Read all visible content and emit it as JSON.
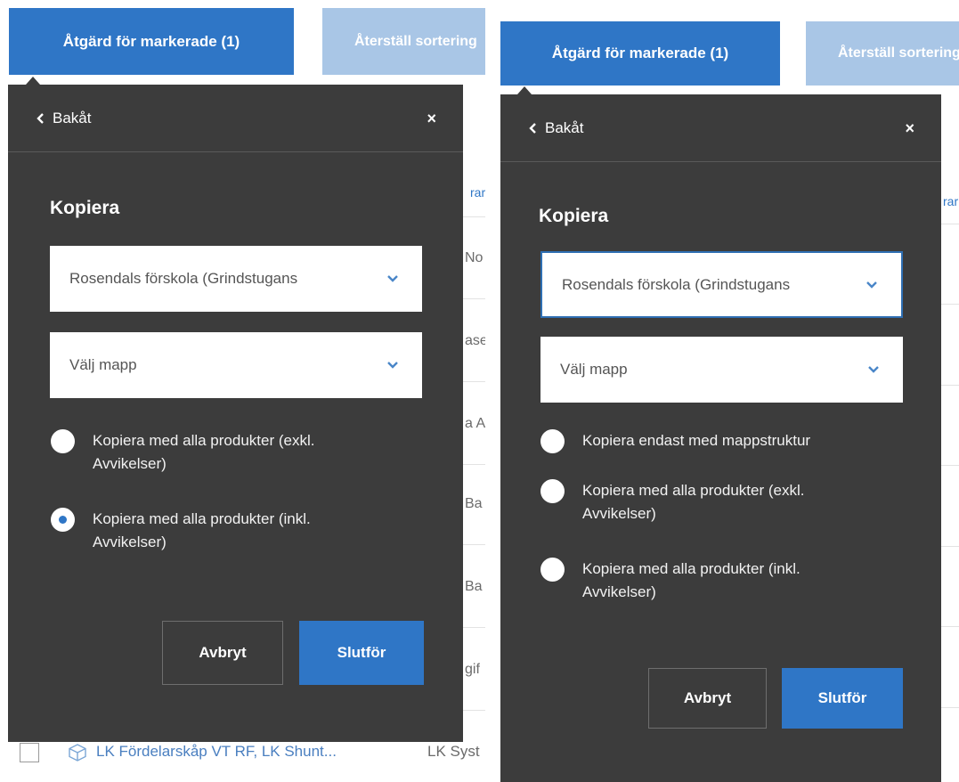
{
  "left": {
    "action_button": "Åtgärd för markerade (1)",
    "reset_button": "Återställ sortering",
    "background_list": {
      "header_fragment": "rar",
      "row_fragments": [
        "No",
        "ase",
        "a A",
        "Ba",
        "Ba",
        "gif"
      ],
      "bottom_row": {
        "name": "LK Fördelarskåp VT RF, LK Shunt...",
        "supplier": "LK Syst"
      }
    },
    "popover": {
      "back_label": "Bakåt",
      "close_label": "×",
      "title": "Kopiera",
      "location_select": "Rosendals förskola (Grindstugans",
      "folder_select": "Välj mapp",
      "options": [
        {
          "label_line1": "Kopiera med alla produkter (exkl.",
          "label_line2": "Avvikelser)",
          "checked": false
        },
        {
          "label_line1": "Kopiera med alla produkter (inkl.",
          "label_line2": "Avvikelser)",
          "checked": true
        }
      ],
      "cancel_label": "Avbryt",
      "finish_label": "Slutför"
    }
  },
  "right": {
    "action_button": "Åtgärd för markerade (1)",
    "reset_button": "Återställ sortering",
    "background_list": {
      "header_fragment": "rar"
    },
    "popover": {
      "back_label": "Bakåt",
      "close_label": "×",
      "title": "Kopiera",
      "location_select": "Rosendals förskola (Grindstugans",
      "folder_select": "Välj mapp",
      "options": [
        {
          "label_line1": "Kopiera endast med mappstruktur",
          "label_line2": "",
          "checked": false
        },
        {
          "label_line1": "Kopiera med alla produkter (exkl.",
          "label_line2": "Avvikelser)",
          "checked": false
        },
        {
          "label_line1": "Kopiera med alla produkter (inkl.",
          "label_line2": "Avvikelser)",
          "checked": false
        }
      ],
      "cancel_label": "Avbryt",
      "finish_label": "Slutför"
    }
  },
  "colors": {
    "primary": "#2f76c6",
    "primary_light": "#a9c6e6",
    "popover_bg": "#3c3c3c",
    "focus_border": "#2f6fb3"
  },
  "icons": {
    "back": "chevron-left-icon",
    "close": "close-icon",
    "dropdown": "chevron-down-icon",
    "product": "box-icon"
  }
}
